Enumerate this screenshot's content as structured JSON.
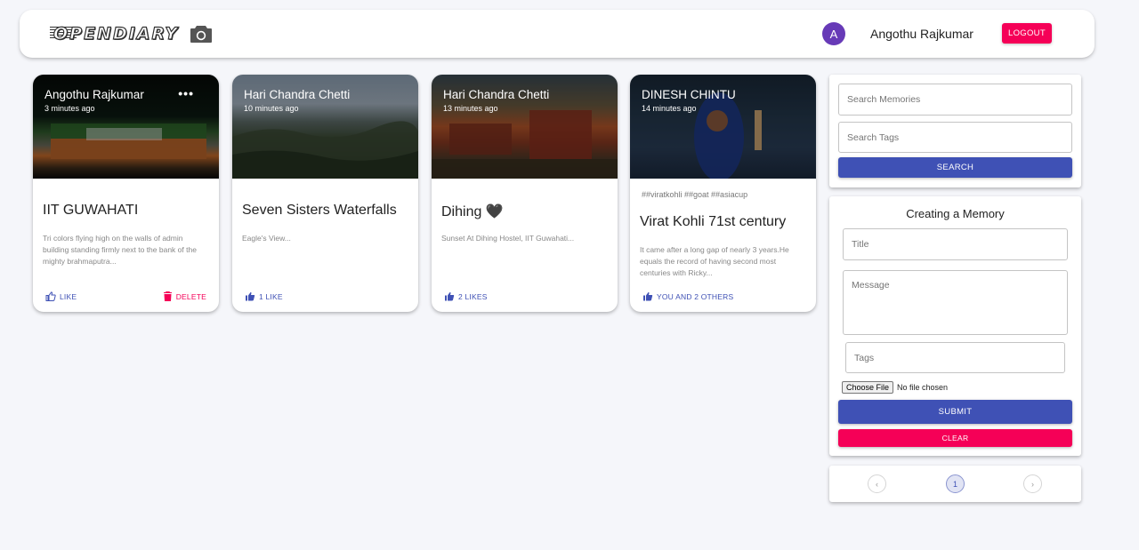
{
  "header": {
    "brand": "OPENDIARY",
    "camera_icon": "camera-icon",
    "avatar_initial": "A",
    "username": "Angothu Rajkumar",
    "logout_label": "LOGOUT"
  },
  "colors": {
    "primary": "#3f51b5",
    "secondary": "#f50057",
    "avatar": "#673ab7"
  },
  "posts": [
    {
      "author": "Angothu Rajkumar",
      "time": "3 minutes ago",
      "tags": "",
      "title": "IIT GUWAHATI",
      "message": "Tri colors flying high on the walls of admin building standing firmly next to the bank of the mighty brahmaputra...",
      "action": "LIKE",
      "delete": "DELETE",
      "more": "•••"
    },
    {
      "author": "Hari Chandra Chetti",
      "time": "10 minutes ago",
      "tags": "",
      "title": "Seven Sisters Waterfalls",
      "message": "Eagle's View...",
      "action": "1 LIKE"
    },
    {
      "author": "Hari Chandra Chetti",
      "time": "13 minutes ago",
      "tags": "",
      "title": "Dihing 🖤",
      "message": "Sunset At Dihing Hostel, IIT Guwahati...",
      "action": "2 LIKES"
    },
    {
      "author": "DINESH CHINTU",
      "time": "14 minutes ago",
      "tags": "##viratkohli ##goat ##asiacup",
      "title": "Virat Kohli 71st century",
      "message": "It came after a long gap of nearly 3 years.He equals the record of having second most centuries with Ricky...",
      "action": "YOU AND 2 OTHERS"
    }
  ],
  "search": {
    "memories_placeholder": "Search Memories",
    "tags_placeholder": "Search Tags",
    "button": "SEARCH"
  },
  "form": {
    "heading": "Creating a Memory",
    "title_placeholder": "Title",
    "message_placeholder": "Message",
    "tags_placeholder": "Tags",
    "file_button": "Choose File",
    "file_status": "No file chosen",
    "submit": "SUBMIT",
    "clear": "CLEAR"
  },
  "pagination": {
    "prev": "‹",
    "current": "1",
    "next": "›"
  }
}
